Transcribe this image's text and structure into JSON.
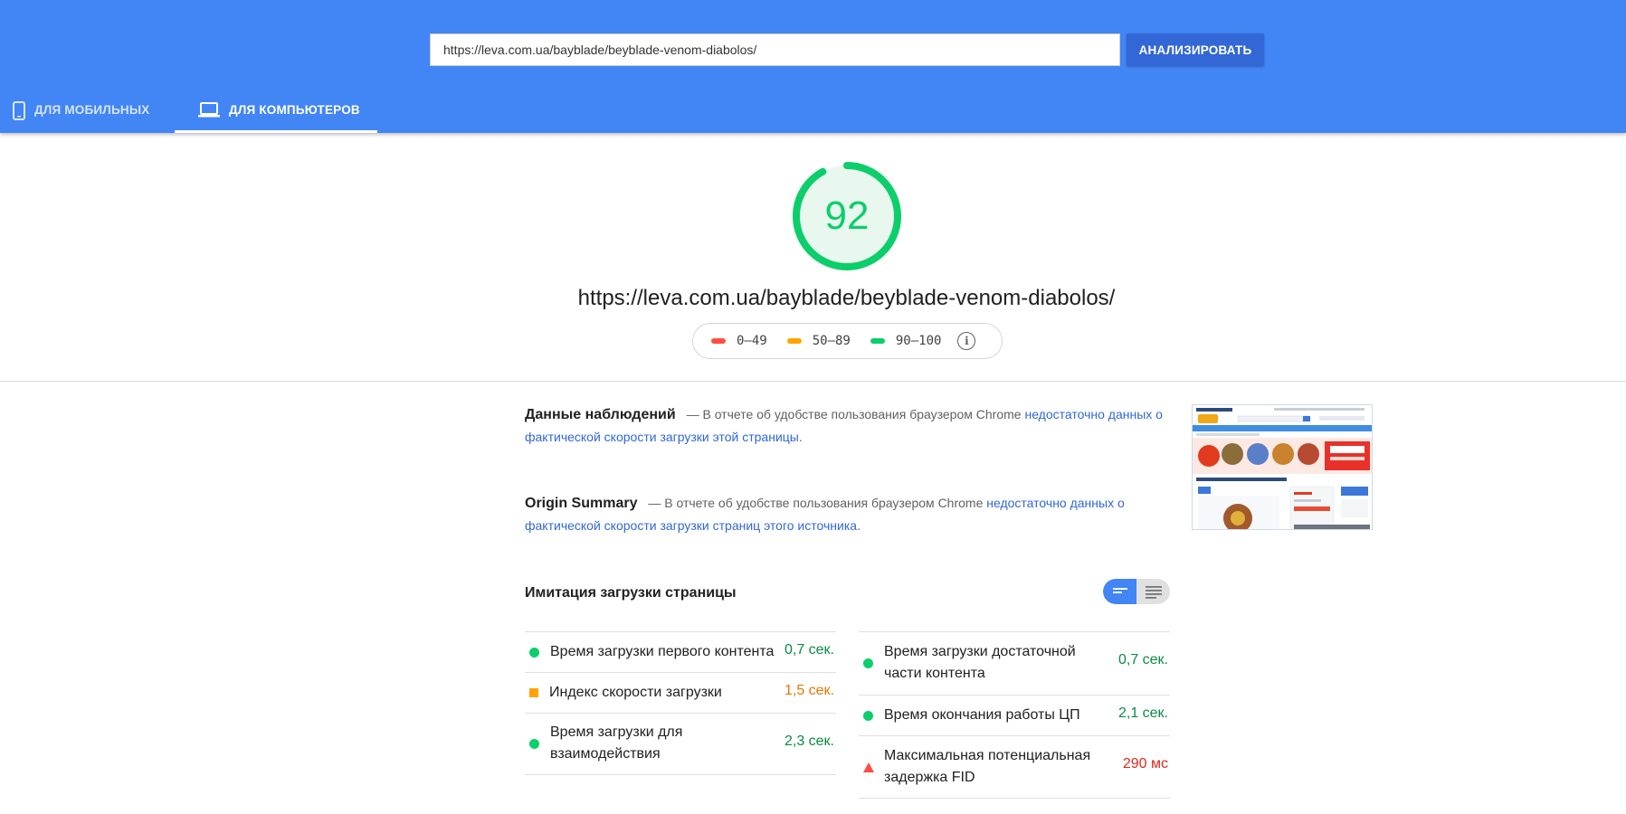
{
  "header": {
    "url_input_value": "https://leva.com.ua/bayblade/beyblade-venom-diabolos/",
    "analyze_label": "АНАЛИЗИРОВАТЬ",
    "tabs": [
      {
        "label": "ДЛЯ МОБИЛЬНЫХ",
        "icon": "smartphone-icon",
        "active": false
      },
      {
        "label": "ДЛЯ КОМПЬЮТЕРОВ",
        "icon": "laptop-icon",
        "active": true
      }
    ]
  },
  "score": {
    "value": "92",
    "fraction": 0.92,
    "color": "#0cce6b",
    "page_url": "https://leva.com.ua/bayblade/beyblade-venom-diabolos/"
  },
  "legend": {
    "items": [
      {
        "label": "0–49",
        "color": "#ff4e42"
      },
      {
        "label": "50–89",
        "color": "#ffa400"
      },
      {
        "label": "90–100",
        "color": "#0cce6b"
      }
    ],
    "info_icon": "info-icon"
  },
  "field_data": {
    "title": "Данные наблюдений",
    "dash_text": "— В отчете об удобстве пользования браузером Chrome",
    "link_text": "недостаточно данных о фактической скорости загрузки этой страницы",
    "end": "."
  },
  "origin_summary": {
    "title": "Origin Summary",
    "dash_text": "— В отчете об удобстве пользования браузером Chrome",
    "link_text": "недостаточно данных о фактической скорости загрузки страниц этого источника",
    "end": "."
  },
  "lab_data": {
    "title": "Имитация загрузки страницы",
    "left_metrics": [
      {
        "name": "Время загрузки первого контента",
        "value": "0,7 сек.",
        "status": "pass"
      },
      {
        "name": "Индекс скорости загрузки",
        "value": "1,5 сек.",
        "status": "average"
      },
      {
        "name": "Время загрузки для взаимодействия",
        "value": "2,3 сек.",
        "status": "pass"
      }
    ],
    "right_metrics": [
      {
        "name": "Время загрузки достаточной части контента",
        "value": "0,7 сек.",
        "status": "pass"
      },
      {
        "name": "Время окончания работы ЦП",
        "value": "2,1 сек.",
        "status": "pass"
      },
      {
        "name": "Максимальная потенциальная задержка FID",
        "value": "290 мс",
        "status": "fail"
      }
    ]
  },
  "colors": {
    "header_bg": "#4285f4",
    "pass": "#0cce6b",
    "average": "#ffa400",
    "fail": "#ff4e42",
    "link": "#3367d6"
  }
}
